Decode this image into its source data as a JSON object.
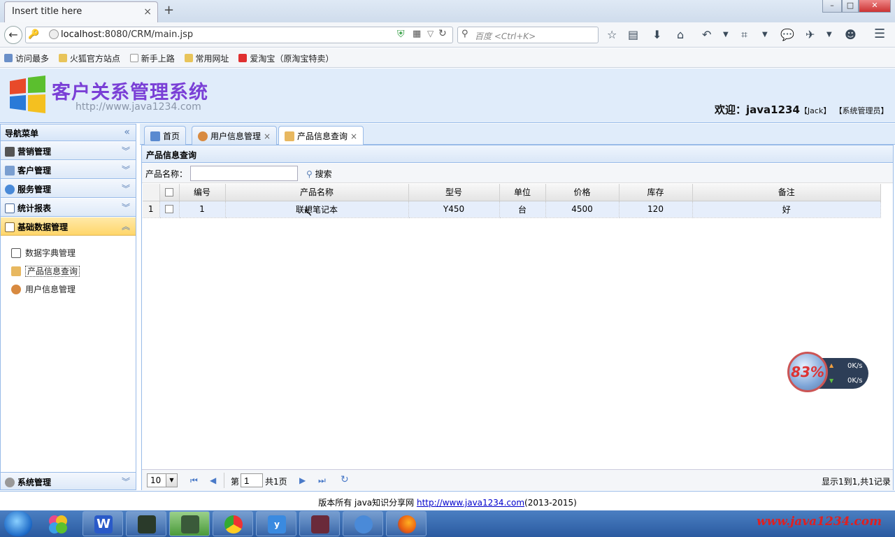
{
  "browser": {
    "tab_title": "Insert title here",
    "tab_close": "×",
    "new_tab": "+",
    "url_host": "localhost",
    "url_rest": ":8080/CRM/main.jsp",
    "search_placeholder": "百度 <Ctrl+K>",
    "bookmarks": [
      "访问最多",
      "火狐官方站点",
      "新手上路",
      "常用网址",
      "爱淘宝（原淘宝特卖）"
    ]
  },
  "app": {
    "title": "客户关系管理系统",
    "url": "http://www.java1234.com",
    "welcome": "欢迎：java1234",
    "user_name": "【Jack】",
    "user_role": "【系统管理员】"
  },
  "sidebar": {
    "header": "导航菜单",
    "collapse_icon": "«",
    "sections": [
      {
        "label": "营销管理",
        "chev": "︾"
      },
      {
        "label": "客户管理",
        "chev": "︾"
      },
      {
        "label": "服务管理",
        "chev": "︾"
      },
      {
        "label": "统计报表",
        "chev": "︾"
      },
      {
        "label": "基础数据管理",
        "chev": "︽"
      }
    ],
    "sub_items": [
      "数据字典管理",
      "产品信息查询",
      "用户信息管理"
    ],
    "bottom_section": {
      "label": "系统管理",
      "chev": "︾"
    }
  },
  "content_tabs": [
    {
      "label": "首页"
    },
    {
      "label": "用户信息管理",
      "close": "×"
    },
    {
      "label": "产品信息查询",
      "close": "×"
    }
  ],
  "panel": {
    "title": "产品信息查询",
    "name_label": "产品名称：",
    "name_value": "",
    "search_label": "搜索"
  },
  "grid": {
    "headers": [
      "编号",
      "产品名称",
      "型号",
      "单位",
      "价格",
      "库存",
      "备注"
    ],
    "rows": [
      {
        "rownum": "1",
        "id": "1",
        "name": "联想笔记本",
        "model": "Y450",
        "unit": "台",
        "price": "4500",
        "stock": "120",
        "remark": "好"
      }
    ]
  },
  "pager": {
    "page_size": "10",
    "page_prefix": "第",
    "page_value": "1",
    "page_total": "共1页",
    "info": "显示1到1,共1记录"
  },
  "footer": {
    "text": "版本所有 java知识分享网 ",
    "link": "http://www.java1234.com",
    "years": "(2013-2015)"
  },
  "speed": {
    "percent": "83%",
    "up": "0K/s",
    "down": "0K/s"
  },
  "watermark": "www.java1234.com",
  "colors": {
    "accent": "#99bbe8",
    "title_purple": "#7a3fd6",
    "selected_section": "#ffd66a"
  }
}
